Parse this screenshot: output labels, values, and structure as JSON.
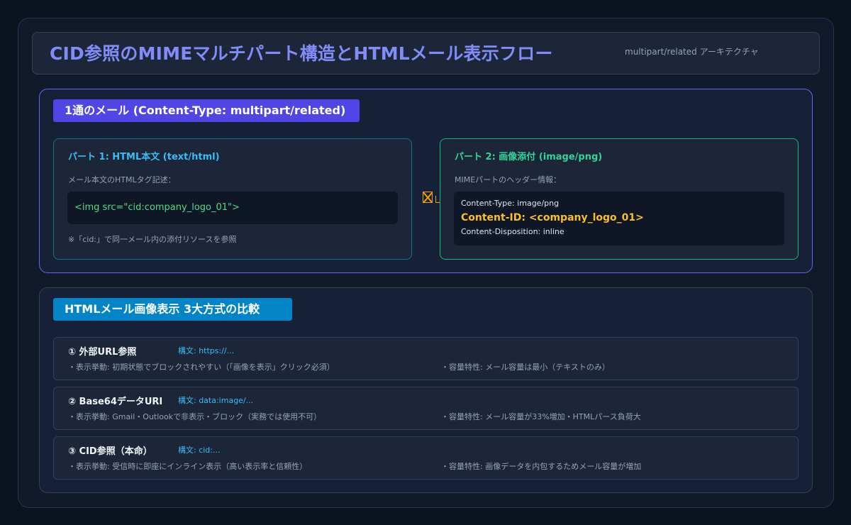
{
  "header": {
    "title": "CID参照のMIMEマルチパート構造とHTMLメール表示フロー",
    "subtitle": "multipart/related アーキテクチャ"
  },
  "email": {
    "tag": "1通のメール (Content-Type: multipart/related)",
    "part1": {
      "title": "パート 1: HTML本文 (text/html)",
      "desc": "メール本文のHTMLタグ記述：",
      "code": "<img src=\"cid:company_logo_01\">",
      "note": "※「cid:」で同一メール内の添付リソースを参照"
    },
    "part2": {
      "title": "パート 2: 画像添付 (image/png)",
      "desc": "MIMEパートのヘッダー情報：",
      "content_type": "Content-Type: image/png",
      "content_id": "Content-ID: <company_logo_01>",
      "content_disposition": "Content-Disposition: inline"
    },
    "link_icon": "link-icon",
    "link_color": "#f59e0b"
  },
  "comparison": {
    "tag": "HTMLメール画像表示 3大方式の比較",
    "methods": [
      {
        "name": "① 外部URL参照",
        "syntax": "構文: https://...",
        "behavior": "・表示挙動: 初期状態でブロックされやすい（「画像を表示」クリック必須）",
        "capacity": "・容量特性: メール容量は最小（テキストのみ）"
      },
      {
        "name": "② Base64データURI",
        "syntax": "構文: data:image/...",
        "behavior": "・表示挙動: Gmail・Outlookで非表示・ブロック（実務では使用不可）",
        "capacity": "・容量特性: メール容量が33%増加・HTMLパース負荷大"
      },
      {
        "name": "③ CID参照（本命）",
        "syntax": "構文: cid:...",
        "behavior": "・表示挙動: 受信時に即座にインライン表示（高い表示率と信頼性）",
        "capacity": "・容量特性: 画像データを内包するためメール容量が増加"
      }
    ]
  },
  "colors": {
    "accent_purple": "#6366f1",
    "accent_blue": "#0284c7",
    "html_part": "#38bdf8",
    "image_part": "#34d399",
    "content_id": "#fbbf24"
  }
}
